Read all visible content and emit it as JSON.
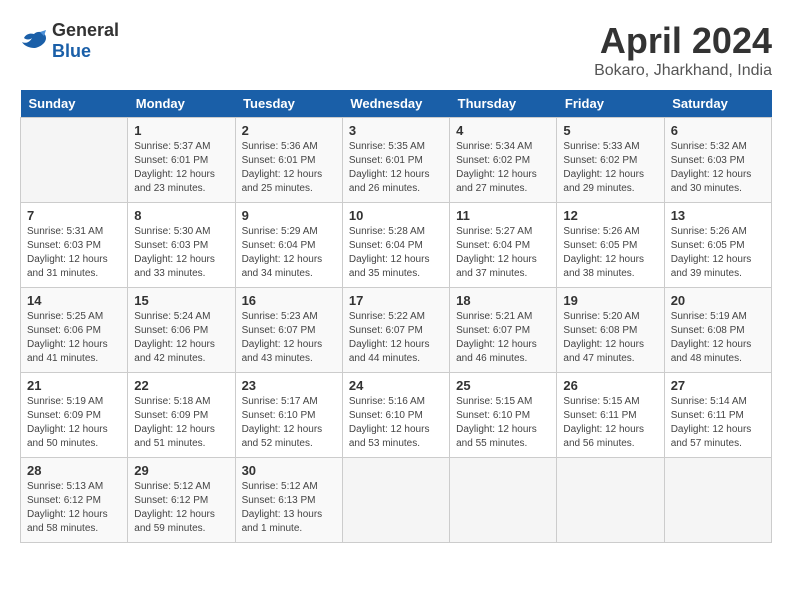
{
  "logo": {
    "general": "General",
    "blue": "Blue"
  },
  "header": {
    "month": "April 2024",
    "location": "Bokaro, Jharkhand, India"
  },
  "weekdays": [
    "Sunday",
    "Monday",
    "Tuesday",
    "Wednesday",
    "Thursday",
    "Friday",
    "Saturday"
  ],
  "weeks": [
    [
      {
        "day": "",
        "info": ""
      },
      {
        "day": "1",
        "info": "Sunrise: 5:37 AM\nSunset: 6:01 PM\nDaylight: 12 hours\nand 23 minutes."
      },
      {
        "day": "2",
        "info": "Sunrise: 5:36 AM\nSunset: 6:01 PM\nDaylight: 12 hours\nand 25 minutes."
      },
      {
        "day": "3",
        "info": "Sunrise: 5:35 AM\nSunset: 6:01 PM\nDaylight: 12 hours\nand 26 minutes."
      },
      {
        "day": "4",
        "info": "Sunrise: 5:34 AM\nSunset: 6:02 PM\nDaylight: 12 hours\nand 27 minutes."
      },
      {
        "day": "5",
        "info": "Sunrise: 5:33 AM\nSunset: 6:02 PM\nDaylight: 12 hours\nand 29 minutes."
      },
      {
        "day": "6",
        "info": "Sunrise: 5:32 AM\nSunset: 6:03 PM\nDaylight: 12 hours\nand 30 minutes."
      }
    ],
    [
      {
        "day": "7",
        "info": "Sunrise: 5:31 AM\nSunset: 6:03 PM\nDaylight: 12 hours\nand 31 minutes."
      },
      {
        "day": "8",
        "info": "Sunrise: 5:30 AM\nSunset: 6:03 PM\nDaylight: 12 hours\nand 33 minutes."
      },
      {
        "day": "9",
        "info": "Sunrise: 5:29 AM\nSunset: 6:04 PM\nDaylight: 12 hours\nand 34 minutes."
      },
      {
        "day": "10",
        "info": "Sunrise: 5:28 AM\nSunset: 6:04 PM\nDaylight: 12 hours\nand 35 minutes."
      },
      {
        "day": "11",
        "info": "Sunrise: 5:27 AM\nSunset: 6:04 PM\nDaylight: 12 hours\nand 37 minutes."
      },
      {
        "day": "12",
        "info": "Sunrise: 5:26 AM\nSunset: 6:05 PM\nDaylight: 12 hours\nand 38 minutes."
      },
      {
        "day": "13",
        "info": "Sunrise: 5:26 AM\nSunset: 6:05 PM\nDaylight: 12 hours\nand 39 minutes."
      }
    ],
    [
      {
        "day": "14",
        "info": "Sunrise: 5:25 AM\nSunset: 6:06 PM\nDaylight: 12 hours\nand 41 minutes."
      },
      {
        "day": "15",
        "info": "Sunrise: 5:24 AM\nSunset: 6:06 PM\nDaylight: 12 hours\nand 42 minutes."
      },
      {
        "day": "16",
        "info": "Sunrise: 5:23 AM\nSunset: 6:07 PM\nDaylight: 12 hours\nand 43 minutes."
      },
      {
        "day": "17",
        "info": "Sunrise: 5:22 AM\nSunset: 6:07 PM\nDaylight: 12 hours\nand 44 minutes."
      },
      {
        "day": "18",
        "info": "Sunrise: 5:21 AM\nSunset: 6:07 PM\nDaylight: 12 hours\nand 46 minutes."
      },
      {
        "day": "19",
        "info": "Sunrise: 5:20 AM\nSunset: 6:08 PM\nDaylight: 12 hours\nand 47 minutes."
      },
      {
        "day": "20",
        "info": "Sunrise: 5:19 AM\nSunset: 6:08 PM\nDaylight: 12 hours\nand 48 minutes."
      }
    ],
    [
      {
        "day": "21",
        "info": "Sunrise: 5:19 AM\nSunset: 6:09 PM\nDaylight: 12 hours\nand 50 minutes."
      },
      {
        "day": "22",
        "info": "Sunrise: 5:18 AM\nSunset: 6:09 PM\nDaylight: 12 hours\nand 51 minutes."
      },
      {
        "day": "23",
        "info": "Sunrise: 5:17 AM\nSunset: 6:10 PM\nDaylight: 12 hours\nand 52 minutes."
      },
      {
        "day": "24",
        "info": "Sunrise: 5:16 AM\nSunset: 6:10 PM\nDaylight: 12 hours\nand 53 minutes."
      },
      {
        "day": "25",
        "info": "Sunrise: 5:15 AM\nSunset: 6:10 PM\nDaylight: 12 hours\nand 55 minutes."
      },
      {
        "day": "26",
        "info": "Sunrise: 5:15 AM\nSunset: 6:11 PM\nDaylight: 12 hours\nand 56 minutes."
      },
      {
        "day": "27",
        "info": "Sunrise: 5:14 AM\nSunset: 6:11 PM\nDaylight: 12 hours\nand 57 minutes."
      }
    ],
    [
      {
        "day": "28",
        "info": "Sunrise: 5:13 AM\nSunset: 6:12 PM\nDaylight: 12 hours\nand 58 minutes."
      },
      {
        "day": "29",
        "info": "Sunrise: 5:12 AM\nSunset: 6:12 PM\nDaylight: 12 hours\nand 59 minutes."
      },
      {
        "day": "30",
        "info": "Sunrise: 5:12 AM\nSunset: 6:13 PM\nDaylight: 13 hours\nand 1 minute."
      },
      {
        "day": "",
        "info": ""
      },
      {
        "day": "",
        "info": ""
      },
      {
        "day": "",
        "info": ""
      },
      {
        "day": "",
        "info": ""
      }
    ]
  ]
}
